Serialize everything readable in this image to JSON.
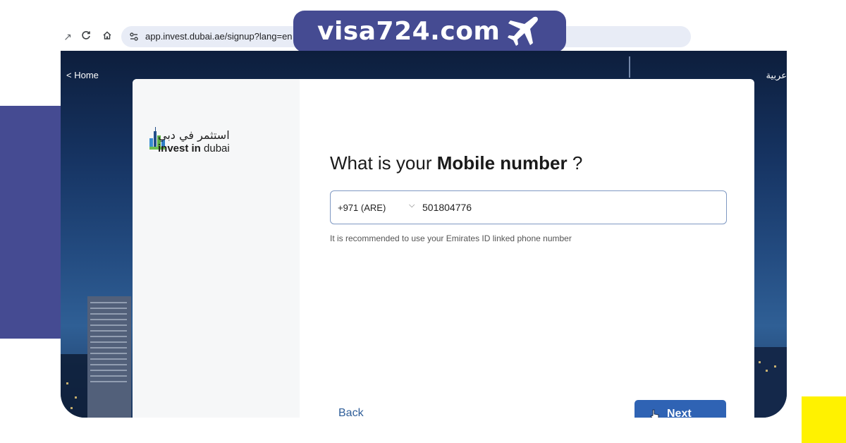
{
  "browser": {
    "url": "app.invest.dubai.ae/signup?lang=en",
    "icons": [
      "back-arrow-icon",
      "reload-icon",
      "home-icon",
      "site-settings-icon"
    ]
  },
  "brand": {
    "text": "visa724.com",
    "icon": "airplane-icon"
  },
  "page": {
    "home_link": "< Home",
    "language_link": "عربية"
  },
  "logo": {
    "arabic": "استثمر في دبي",
    "english_bold": "invest in",
    "english_regular": " dubai"
  },
  "form": {
    "heading_prefix": "What is your ",
    "heading_bold": "Mobile number",
    "heading_suffix": " ?",
    "country_code": "+971 (ARE)",
    "phone_value": "501804776",
    "hint": "It is recommended to use your Emirates ID linked phone number"
  },
  "actions": {
    "back_label": "Back",
    "next_label": "Next"
  },
  "colors": {
    "brand_purple": "#454b92",
    "accent_yellow": "#fff200",
    "primary_button": "#2f63b4",
    "field_border": "#7f98c2"
  }
}
